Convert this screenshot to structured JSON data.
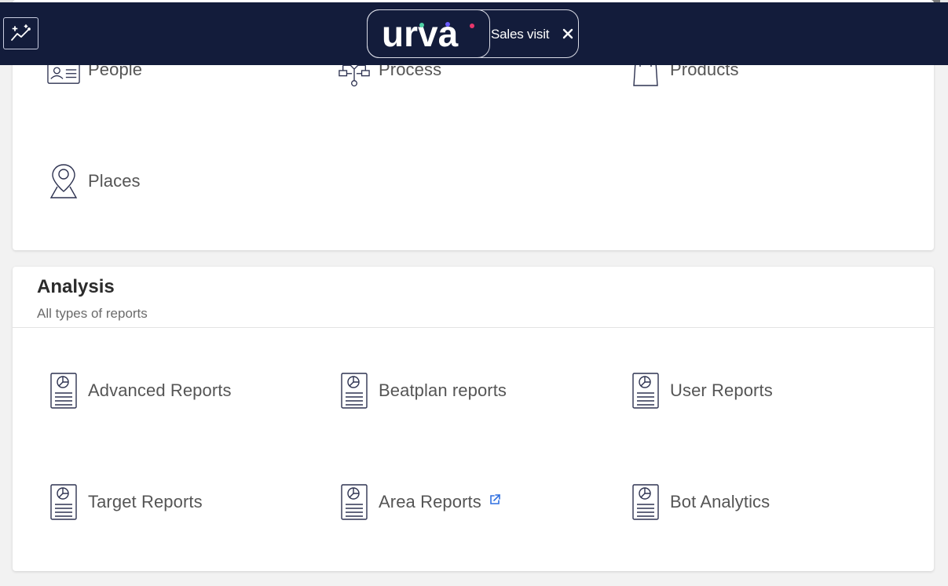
{
  "header": {
    "logo_text": "urva",
    "chip_label": "Sales visit",
    "colors": {
      "bar": "#131c3b",
      "logo_accent_red": "#e8366b",
      "logo_accent_green": "#4fd1a5",
      "logo_accent_purple": "#6a5cff"
    }
  },
  "modules": {
    "items": [
      {
        "label": "People",
        "icon": "id-card-icon"
      },
      {
        "label": "Process",
        "icon": "flowchart-icon"
      },
      {
        "label": "Products",
        "icon": "shopping-bag-icon"
      },
      {
        "label": "Places",
        "icon": "map-pin-icon"
      }
    ]
  },
  "analysis": {
    "title": "Analysis",
    "subtitle": "All types of reports",
    "reports": [
      {
        "label": "Advanced Reports",
        "icon": "report-icon"
      },
      {
        "label": "Beatplan reports",
        "icon": "report-icon"
      },
      {
        "label": "User Reports",
        "icon": "report-icon"
      },
      {
        "label": "Target Reports",
        "icon": "report-icon"
      },
      {
        "label": "Area Reports",
        "icon": "report-icon",
        "external": true
      },
      {
        "label": "Bot Analytics",
        "icon": "report-icon"
      }
    ]
  }
}
